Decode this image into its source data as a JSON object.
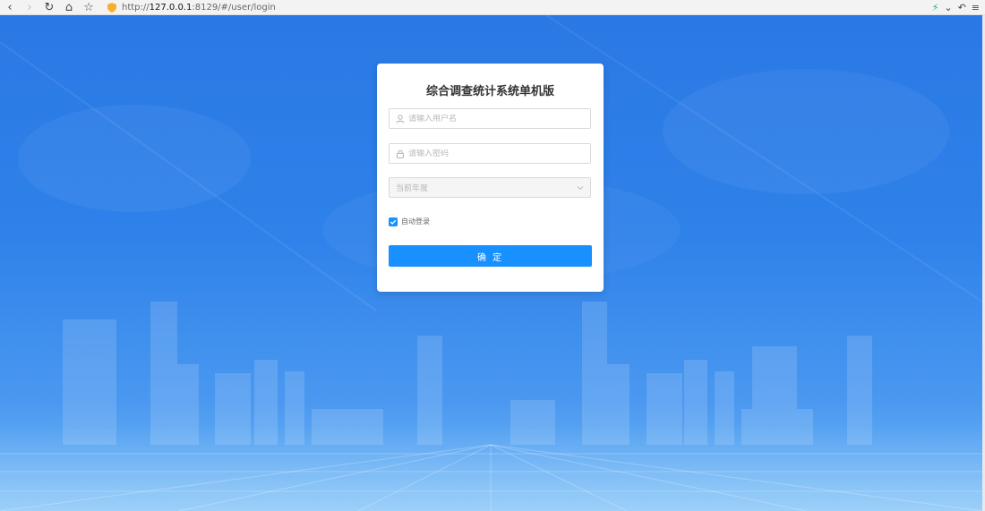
{
  "browser": {
    "url_protocol": "http://",
    "url_host": "127.0.0.1",
    "url_rest": ":8129/#/user/login",
    "icons": [
      "back-icon",
      "forward-icon",
      "reload-icon",
      "home-icon",
      "star-icon",
      "shield-icon",
      "bolt-icon",
      "chevron-down-icon",
      "undo-icon",
      "menu-icon"
    ]
  },
  "login": {
    "title": "综合调查统计系统单机版",
    "username_placeholder": "请输入用户名",
    "password_placeholder": "请输入密码",
    "year_placeholder": "当前年度",
    "remember_label": "自动登录",
    "remember_checked": true,
    "submit_label": "确 定"
  },
  "colors": {
    "primary": "#1890ff",
    "background_top": "#2a78e4",
    "background_bottom": "#7cc0f7"
  }
}
